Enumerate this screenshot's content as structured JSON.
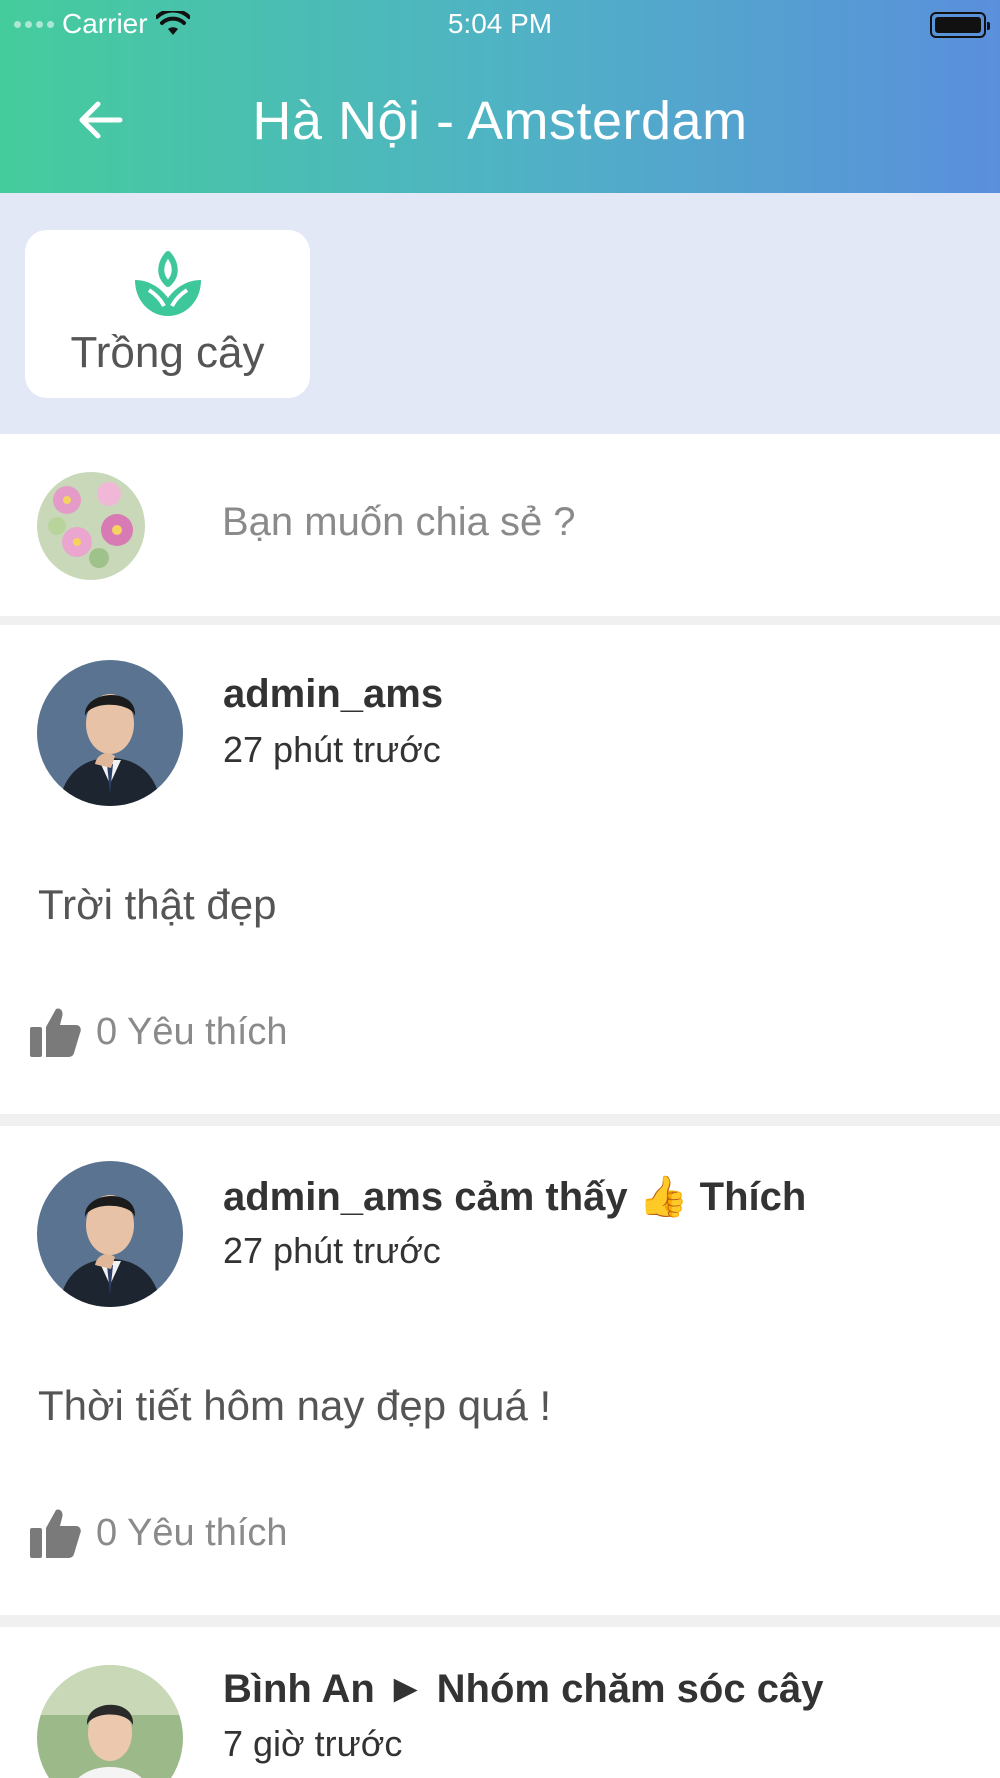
{
  "status_bar": {
    "carrier": "Carrier",
    "time": "5:04 PM"
  },
  "header": {
    "title": "Hà Nội - Amsterdam",
    "back_icon": "arrow-left-icon"
  },
  "categories": [
    {
      "label": "Trồng cây",
      "icon": "plant-icon",
      "icon_color": "#3ec79a"
    }
  ],
  "composer": {
    "placeholder": "Bạn muốn chia sẻ ?"
  },
  "posts": [
    {
      "author": "admin_ams",
      "time": "27 phút trước",
      "content": "Trời thật đẹp",
      "likes": "0 Yêu thích"
    },
    {
      "author": "admin_ams cảm thấy 👍 Thích",
      "time": "27 phút trước",
      "content": "Thời tiết hôm nay đẹp quá !",
      "likes": "0 Yêu thích"
    },
    {
      "author": "Bình An ► Nhóm chăm sóc cây",
      "time": "7 giờ trước"
    }
  ],
  "colors": {
    "header_gradient_start": "#45cc9c",
    "header_gradient_end": "#5a8fdc",
    "category_background": "#e2e8f6",
    "muted_text": "#8a8a8a"
  }
}
